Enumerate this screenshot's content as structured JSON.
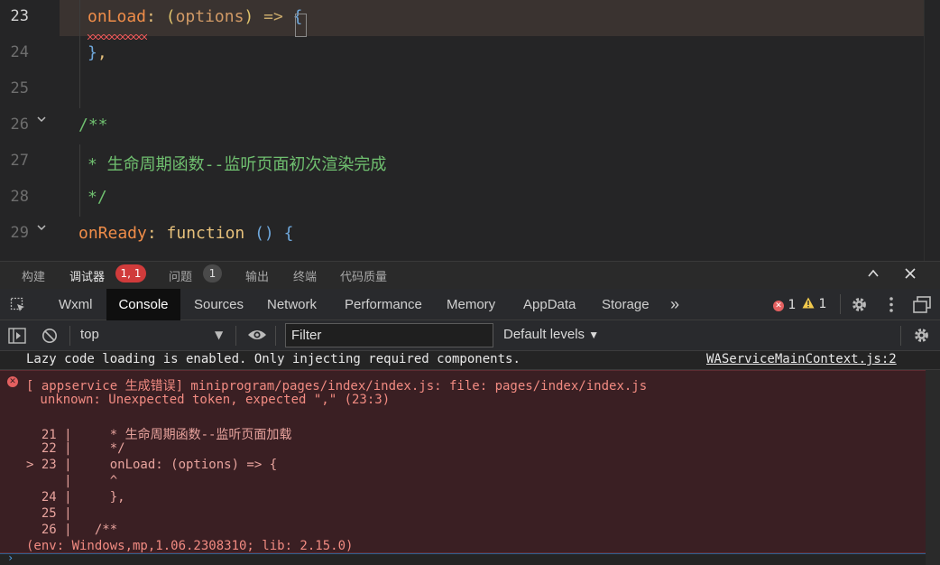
{
  "editor": {
    "lines": [
      {
        "num": "23",
        "active": true,
        "fold": false,
        "indent": 97,
        "tokens": [
          {
            "t": "onLoad",
            "c": "k"
          },
          {
            "t": ": ",
            "c": "pl"
          },
          {
            "t": "(",
            "c": "br"
          },
          {
            "t": "options",
            "c": "p"
          },
          {
            "t": ")",
            "c": "br"
          },
          {
            "t": " => ",
            "c": "op"
          },
          {
            "t": "{",
            "c": "bl"
          }
        ]
      },
      {
        "num": "24",
        "active": false,
        "fold": false,
        "indent": 97,
        "tokens": [
          {
            "t": "}",
            "c": "bl"
          },
          {
            "t": ",",
            "c": "pl"
          }
        ]
      },
      {
        "num": "25",
        "active": false,
        "fold": false,
        "indent": 97,
        "tokens": []
      },
      {
        "num": "26",
        "active": false,
        "fold": true,
        "indent": 87,
        "tokens": [
          {
            "t": "/**",
            "c": "cm"
          }
        ]
      },
      {
        "num": "27",
        "active": false,
        "fold": false,
        "indent": 97,
        "tokens": [
          {
            "t": "* 生命周期函数--监听页面初次渲染完成",
            "c": "cm"
          }
        ]
      },
      {
        "num": "28",
        "active": false,
        "fold": false,
        "indent": 97,
        "tokens": [
          {
            "t": "*/",
            "c": "cm"
          }
        ]
      },
      {
        "num": "29",
        "active": false,
        "fold": true,
        "indent": 87,
        "tokens": [
          {
            "t": "onReady",
            "c": "k"
          },
          {
            "t": ": ",
            "c": "pl"
          },
          {
            "t": "function",
            "c": "kw"
          },
          {
            "t": " ",
            "c": "pl"
          },
          {
            "t": "()",
            "c": "bl"
          },
          {
            "t": " {",
            "c": "bl"
          }
        ]
      }
    ]
  },
  "devtools_top": {
    "tabs": [
      "构建",
      "调试器",
      "问题",
      "输出",
      "终端",
      "代码质量"
    ],
    "debugger_badge": "1, 1",
    "issues_badge": "1",
    "controls": {
      "collapse": "^",
      "close": "×"
    }
  },
  "panels": {
    "tabs": [
      "Wxml",
      "Console",
      "Sources",
      "Network",
      "Performance",
      "Memory",
      "AppData",
      "Storage"
    ],
    "active": "Console",
    "more": "»",
    "error_count": "1",
    "warning_count": "1"
  },
  "toolbar": {
    "context": "top",
    "filter_placeholder": "Filter",
    "levels": "Default levels"
  },
  "console": {
    "info_text": "Lazy code loading is enabled. Only injecting required components.",
    "info_source": "WAServiceMainContext.js:2",
    "error_lines": [
      "[ appservice 生成错误] miniprogram/pages/index/index.js: file: pages/index/index.js",
      " unknown: Unexpected token, expected \",\" (23:3)",
      "",
      "  21 |     * 生命周期函数--监听页面加载",
      "  22 |     */",
      "> 23 |     onLoad: (options) => {",
      "     |     ^",
      "  24 |     },",
      "  25 |",
      "  26 |   /**",
      "(env: Windows,mp,1.06.2308310; lib: 2.15.0)"
    ]
  },
  "colors": {
    "accent_error": "#d03b3b",
    "warning": "#f2c94c",
    "error_text": "#f28b82"
  }
}
